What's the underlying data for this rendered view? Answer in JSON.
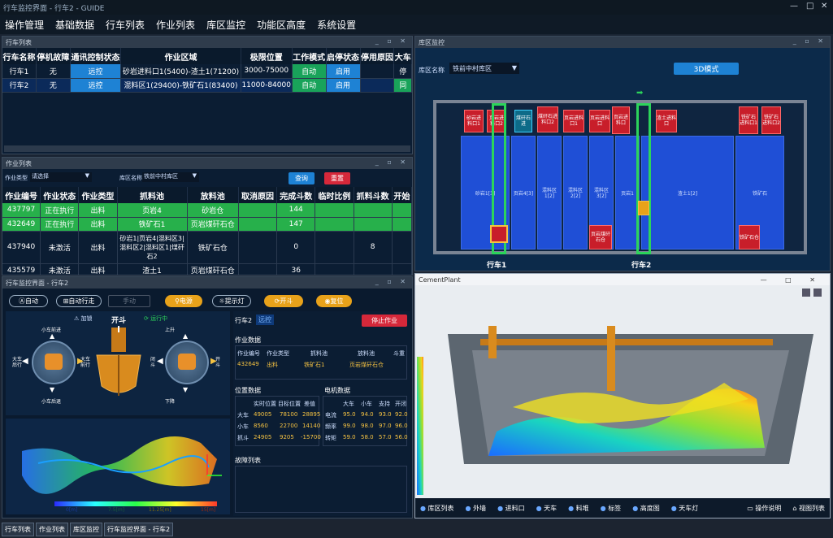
{
  "window": {
    "title": "行车监控界面 - 行车2 - GUIDE",
    "wc": [
      "—",
      "□",
      "✕"
    ]
  },
  "menu": [
    "操作管理",
    "基础数据",
    "行车列表",
    "作业列表",
    "库区监控",
    "功能区高度",
    "系统设置"
  ],
  "crane_panel": {
    "title": "行车列表",
    "headers": [
      "行车名称",
      "停机故障",
      "通讯控制状态",
      "作业区域",
      "极限位置",
      "工作模式",
      "启停状态",
      "停用原因",
      "大车"
    ],
    "rows": [
      [
        "行车1",
        "无",
        "远控",
        "砂岩进料口1(5400)-渣土1(71200)",
        "3000-75000",
        "自动",
        "启用",
        "",
        "停"
      ],
      [
        "行车2",
        "无",
        "远控",
        "混料区1(29400)-铁矿石1(83400)",
        "11000-84000",
        "自动",
        "启用",
        "",
        "同"
      ]
    ]
  },
  "job_panel": {
    "title": "作业列表",
    "filter1_label": "作业类型",
    "filter1_value": "请选择",
    "filter2_label": "库区名称",
    "filter2_value": "铁前中村库区",
    "query": "查询",
    "reset": "重置",
    "headers": [
      "作业编号",
      "作业状态",
      "作业类型",
      "抓料池",
      "放料池",
      "取消原因",
      "完成斗数",
      "临时比例",
      "抓料斗数",
      "开始"
    ],
    "rows": [
      [
        "437797",
        "正在执行",
        "出料",
        "页岩4",
        "砂岩仓",
        "",
        "144",
        "",
        "",
        ""
      ],
      [
        "432649",
        "正在执行",
        "出料",
        "铁矿石1",
        "页岩煤矸石仓",
        "",
        "147",
        "",
        "",
        ""
      ],
      [
        "437940",
        "未激活",
        "出料",
        "砂岩1|页岩4|混料区3|混料区2|混料区1|煤矸石2",
        "铁矿石仓",
        "",
        "0",
        "",
        "8",
        ""
      ],
      [
        "435579",
        "未激活",
        "出料",
        "渣土1",
        "页岩煤矸石仓",
        "",
        "36",
        "",
        "",
        ""
      ]
    ]
  },
  "monitor_panel": {
    "title": "行车监控界面 - 行车2",
    "btns": [
      "自动",
      "自动行走",
      "手动",
      "电源",
      "提示灯",
      "开斗",
      "复位"
    ],
    "crane_label": "行车2",
    "mode": "远控",
    "stop": "停止作业",
    "unlock": "加锁",
    "grab": "开斗",
    "running": "运行中",
    "small_fwd": "小车前进",
    "small_back": "小车后退",
    "big_back": "大车后行",
    "big_fwd": "大车前行",
    "up": "上升",
    "down": "下降",
    "close": "闭斗",
    "open": "开斗",
    "sec_job": "作业数据",
    "job_headers": [
      "作业编号",
      "作业类型",
      "抓料池",
      "放料池",
      "斗重"
    ],
    "job_row": [
      "432649",
      "出料",
      "铁矿石1",
      "页岩煤矸石仓",
      ""
    ],
    "sec_pos": "位置数据",
    "pos_headers": [
      "实时位置",
      "目标位置",
      "差值"
    ],
    "pos_rows": [
      [
        "大车",
        "49005",
        "78100",
        "28895"
      ],
      [
        "小车",
        "8560",
        "22700",
        "14140"
      ],
      [
        "抓斗",
        "24905",
        "9205",
        "-15700"
      ]
    ],
    "sec_motor": "电机数据",
    "motor_headers": [
      "大车",
      "小车",
      "支持",
      "开闭"
    ],
    "motor_rows": [
      [
        "电流",
        "95.0",
        "94.0",
        "93.0",
        "92.0"
      ],
      [
        "频率",
        "99.0",
        "98.0",
        "97.0",
        "96.0"
      ],
      [
        "转矩",
        "59.0",
        "58.0",
        "57.0",
        "56.0"
      ]
    ],
    "sec_fault": "故障列表",
    "scale": [
      "0[m]",
      "7.5[m]",
      "11.25[m]",
      "15[m]"
    ]
  },
  "yard_panel": {
    "title": "库区监控",
    "area_label": "库区名称",
    "area_value": "铁前中村库区",
    "mode_btn": "3D模式",
    "crane1": "行车1",
    "crane2": "行车2",
    "top_boxes": [
      "砂岩进料口1",
      "页岩进料口2",
      "煤矸石进",
      "煤矸石进料口2",
      "页岩进料口1",
      "页岩进料口",
      "页岩进料口",
      "渣土进料口",
      "铁矿石进料口1",
      "铁矿石进料口2"
    ],
    "bays": [
      "砂岩1[3]",
      "页岩4[3]",
      "混料区1[2]",
      "混料区2[2]",
      "混料区3[2]",
      "页岩1",
      "渣土1[2]",
      "铁矿石"
    ],
    "bottom_boxes": [
      "页岩煤矸石仓",
      "铁矿石仓"
    ]
  },
  "cement_panel": {
    "title": "CementPlant",
    "legend": [
      "库区列表",
      "外墙",
      "进料口",
      "天车",
      "料堆",
      "标签",
      "高度图",
      "天车灯"
    ],
    "help": "操作说明",
    "view": "视图列表"
  },
  "taskbar": [
    "行车列表",
    "作业列表",
    "库区监控",
    "行车监控界面 - 行车2"
  ],
  "colors": {
    "accent": "#1e82d4",
    "green": "#27b04b",
    "red": "#c81e2a",
    "panel": "#0b1d33"
  }
}
